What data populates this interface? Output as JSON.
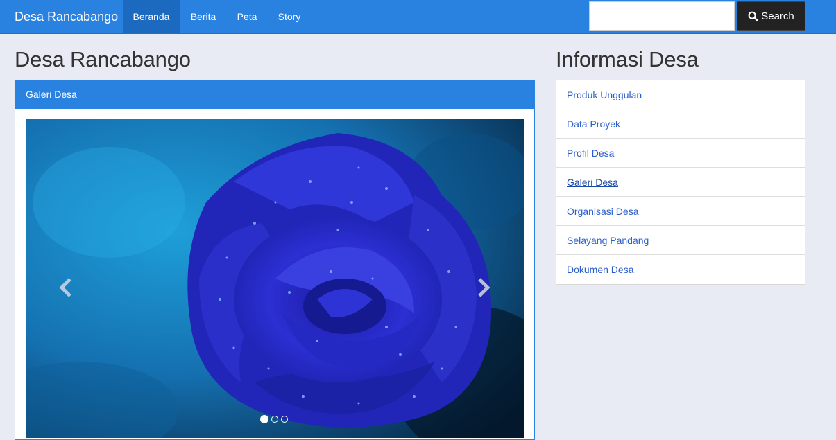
{
  "navbar": {
    "brand": "Desa Rancabango",
    "items": [
      {
        "label": "Beranda",
        "active": true
      },
      {
        "label": "Berita",
        "active": false
      },
      {
        "label": "Peta",
        "active": false
      },
      {
        "label": "Story",
        "active": false
      }
    ],
    "search": {
      "placeholder": "",
      "value": "",
      "button_label": "Search",
      "icon": "search-icon"
    }
  },
  "main": {
    "title": "Desa Rancabango",
    "panel_title": "Galeri Desa",
    "carousel": {
      "slide_image": "blue rose with water droplets",
      "slides_count": 3,
      "active_slide": 1
    }
  },
  "sidebar": {
    "title": "Informasi Desa",
    "links": [
      {
        "label": "Produk Unggulan"
      },
      {
        "label": "Data Proyek"
      },
      {
        "label": "Profil Desa"
      },
      {
        "label": "Galeri Desa"
      },
      {
        "label": "Organisasi Desa"
      },
      {
        "label": "Selayang Pandang"
      },
      {
        "label": "Dokumen Desa"
      }
    ]
  },
  "colors": {
    "navbar": "#2a82e0",
    "nav_active": "#1c6abf",
    "link": "#2a5fcc",
    "background": "#e8eaf4"
  }
}
